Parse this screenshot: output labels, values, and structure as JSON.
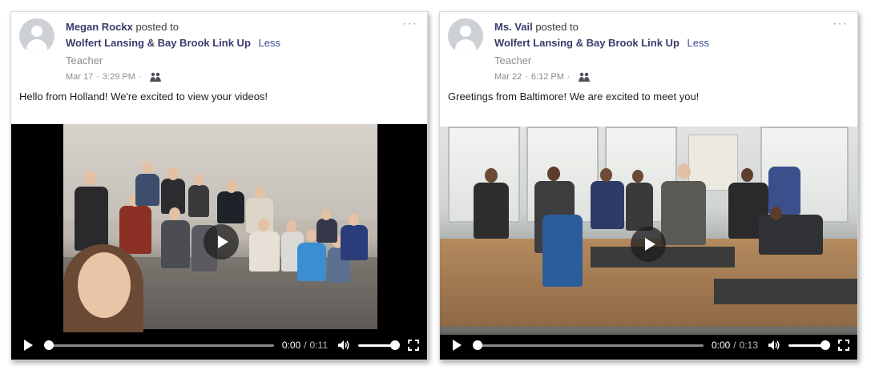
{
  "posts": [
    {
      "author": "Megan Rockx",
      "posted_to": "posted to",
      "group": "Wolfert Lansing & Bay Brook Link Up",
      "less": "Less",
      "role": "Teacher",
      "date": "Mar 17",
      "time": "3:29 PM",
      "more": "···",
      "message": "Hello from Holland! We're excited to view your videos!",
      "video": {
        "current": "0:00",
        "separator": "/",
        "duration": "0:11",
        "progress": 0,
        "volume": 1.0
      }
    },
    {
      "author": "Ms. Vail",
      "posted_to": "posted to",
      "group": "Wolfert Lansing & Bay Brook Link Up",
      "less": "Less",
      "role": "Teacher",
      "date": "Mar 22",
      "time": "6:12 PM",
      "more": "···",
      "message": "Greetings from Baltimore! We are excited to meet you!",
      "video": {
        "current": "0:00",
        "separator": "/",
        "duration": "0:13",
        "progress": 0,
        "volume": 1.0
      }
    }
  ],
  "icons": [
    "avatar-icon",
    "group-icon",
    "more-icon",
    "play-icon",
    "volume-icon",
    "fullscreen-icon"
  ],
  "colors": {
    "link": "#3a3b6b",
    "muted": "#8a8d91",
    "less": "#3a4b9c"
  }
}
